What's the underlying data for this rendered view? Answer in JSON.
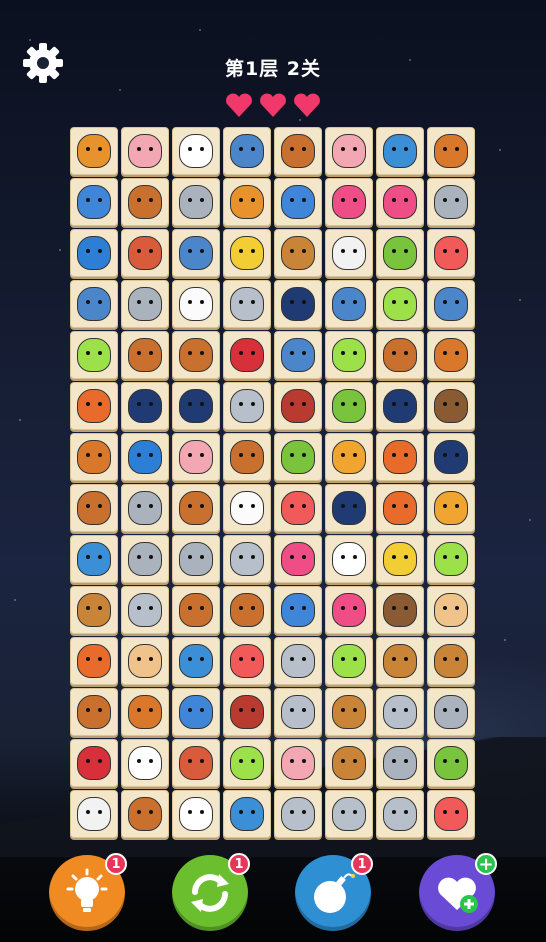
{
  "header": {
    "title": "第1层 2关"
  },
  "lives": 3,
  "colors": {
    "tile_bg": "#f4e6c8",
    "heart": "#f0386b",
    "hint": "#f08a22",
    "shuffle": "#6bbf2f",
    "bomb": "#2f8fd3",
    "life": "#6a4bd6",
    "badge": "#e8365a"
  },
  "animal_colors": {
    "lion": "#e8922c",
    "pig": "#f3a7b2",
    "cow": "#ffffff",
    "shark": "#4a86c9",
    "horse": "#c9702e",
    "dolphin": "#3a8fd6",
    "raccoon": "#d9772b",
    "rhino": "#3f86d8",
    "elephant": "#aab3bd",
    "octopus": "#ee4d86",
    "cat": "#2d7fd6",
    "hedgehog": "#d85b3c",
    "giraffe": "#f2cd34",
    "ox": "#c98438",
    "sheep": "#f2f2f2",
    "parrot": "#79c43c",
    "fish": "#f25a5a",
    "chick": "#fbfbfb",
    "mouse": "#b7bfca",
    "orca": "#203a73",
    "angelfish": "#9ce14a",
    "monkey-red": "#d7303a",
    "fox": "#e86b2c",
    "boar": "#b93b2f",
    "bear": "#8a5a33",
    "tiger": "#f1a531",
    "monkey": "#f0c38a"
  },
  "board": [
    [
      "lion",
      "pig",
      "cow",
      "shark",
      "horse",
      "pig",
      "dolphin",
      "raccoon"
    ],
    [
      "rhino",
      "horse",
      "elephant",
      "lion",
      "rhino",
      "octopus",
      "octopus",
      "elephant"
    ],
    [
      "cat",
      "hedgehog",
      "shark",
      "giraffe",
      "ox",
      "sheep",
      "parrot",
      "fish"
    ],
    [
      "shark",
      "elephant",
      "chick",
      "mouse",
      "orca",
      "shark",
      "angelfish",
      "shark"
    ],
    [
      "angelfish",
      "horse",
      "horse",
      "monkey-red",
      "shark",
      "angelfish",
      "horse",
      "raccoon"
    ],
    [
      "fox",
      "orca",
      "orca",
      "mouse",
      "boar",
      "parrot",
      "orca",
      "bear"
    ],
    [
      "raccoon",
      "cat",
      "pig",
      "horse",
      "parrot",
      "tiger",
      "fox",
      "orca"
    ],
    [
      "horse",
      "elephant",
      "horse",
      "chick",
      "fish",
      "orca",
      "fox",
      "tiger"
    ],
    [
      "dolphin",
      "elephant",
      "elephant",
      "mouse",
      "octopus",
      "cow",
      "giraffe",
      "angelfish"
    ],
    [
      "ox",
      "mouse",
      "horse",
      "horse",
      "rhino",
      "octopus",
      "bear",
      "monkey"
    ],
    [
      "fox",
      "monkey",
      "dolphin",
      "fish",
      "mouse",
      "angelfish",
      "ox",
      "ox"
    ],
    [
      "horse",
      "raccoon",
      "rhino",
      "boar",
      "mouse",
      "ox",
      "mouse",
      "elephant"
    ],
    [
      "monkey-red",
      "cow",
      "hedgehog",
      "angelfish",
      "pig",
      "ox",
      "elephant",
      "parrot"
    ],
    [
      "sheep",
      "horse",
      "cow",
      "dolphin",
      "mouse",
      "mouse",
      "mouse",
      "fish"
    ]
  ],
  "powerups": [
    {
      "name": "hint",
      "badge": "1"
    },
    {
      "name": "shuffle",
      "badge": "1"
    },
    {
      "name": "bomb",
      "badge": "1"
    },
    {
      "name": "add-life",
      "badge": "+"
    }
  ]
}
